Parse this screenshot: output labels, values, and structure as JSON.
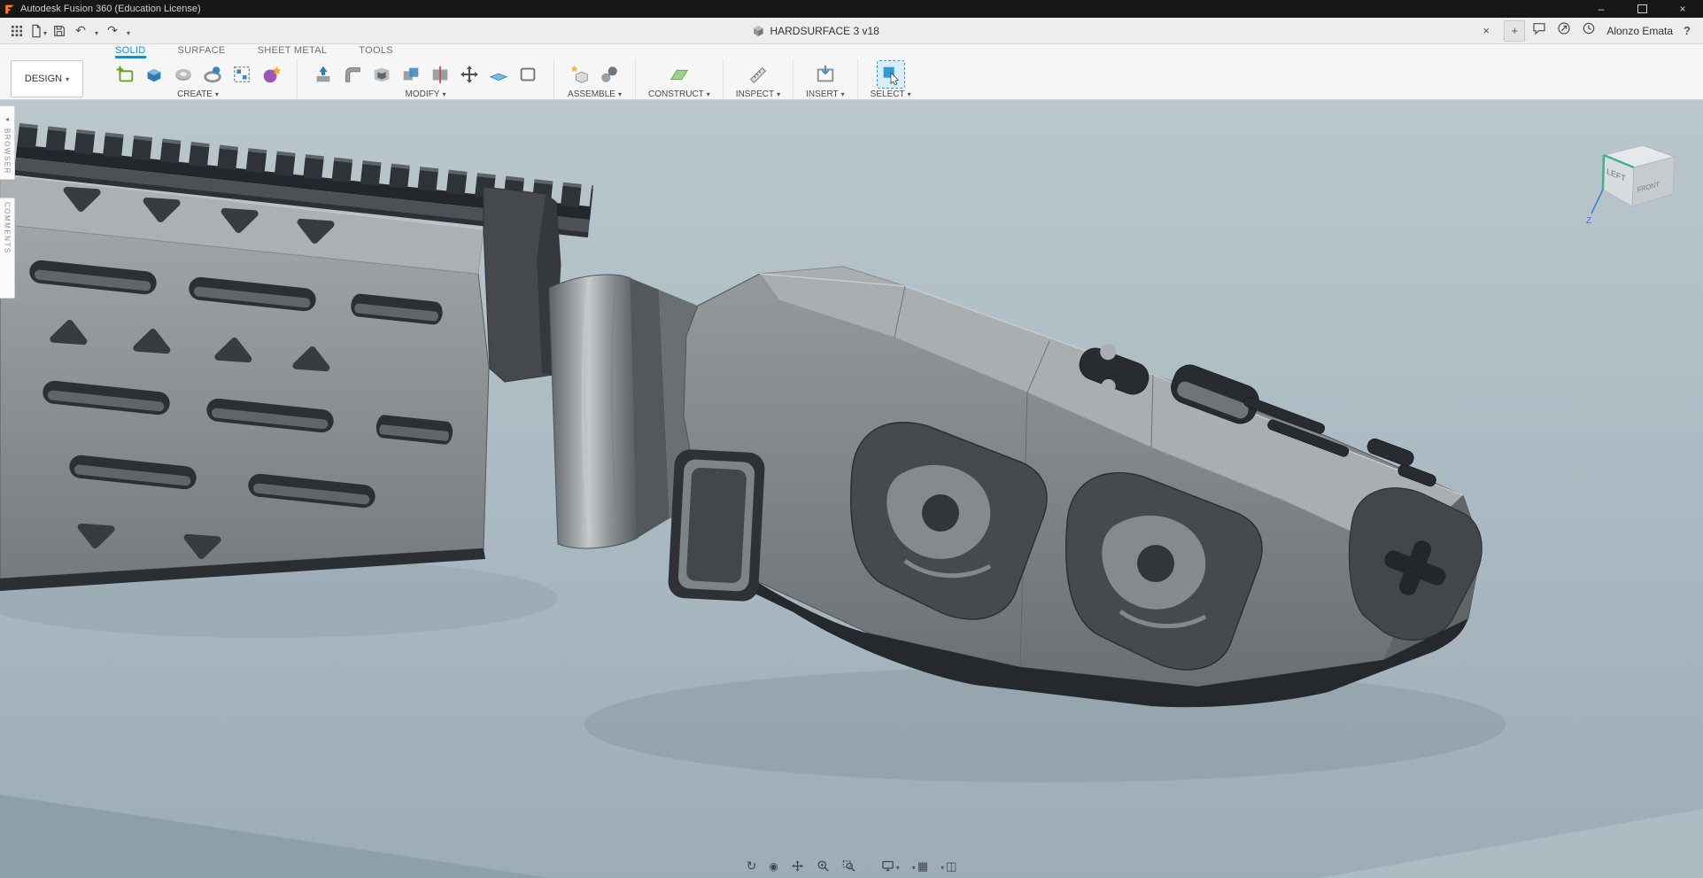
{
  "title_bar": {
    "title": "Autodesk Fusion 360 (Education License)"
  },
  "app_bar": {
    "tab_label": "HARDSURFACE 3 v18",
    "user_name": "Alonzo Emata",
    "help_label": "?"
  },
  "ribbon": {
    "tabs": [
      {
        "label": "SOLID",
        "active": true
      },
      {
        "label": "SURFACE",
        "active": false
      },
      {
        "label": "SHEET METAL",
        "active": false
      },
      {
        "label": "TOOLS",
        "active": false
      }
    ]
  },
  "toolbar": {
    "design_label": "DESIGN",
    "groups": [
      {
        "label": "CREATE"
      },
      {
        "label": "MODIFY"
      },
      {
        "label": "ASSEMBLE"
      },
      {
        "label": "CONSTRUCT"
      },
      {
        "label": "INSPECT"
      },
      {
        "label": "INSERT"
      },
      {
        "label": "SELECT"
      }
    ]
  },
  "panels": {
    "browser_label": "BROWSER",
    "comments_label": "COMMENTS"
  },
  "viewcube": {
    "left_label": "LEFT",
    "front_label": "FRONT",
    "z_label": "Z"
  },
  "colors": {
    "accent_blue": "#0696d7",
    "titlebar": "#171717",
    "viewport_top": "#bac7cd",
    "viewport_bottom": "#9dadb7"
  }
}
